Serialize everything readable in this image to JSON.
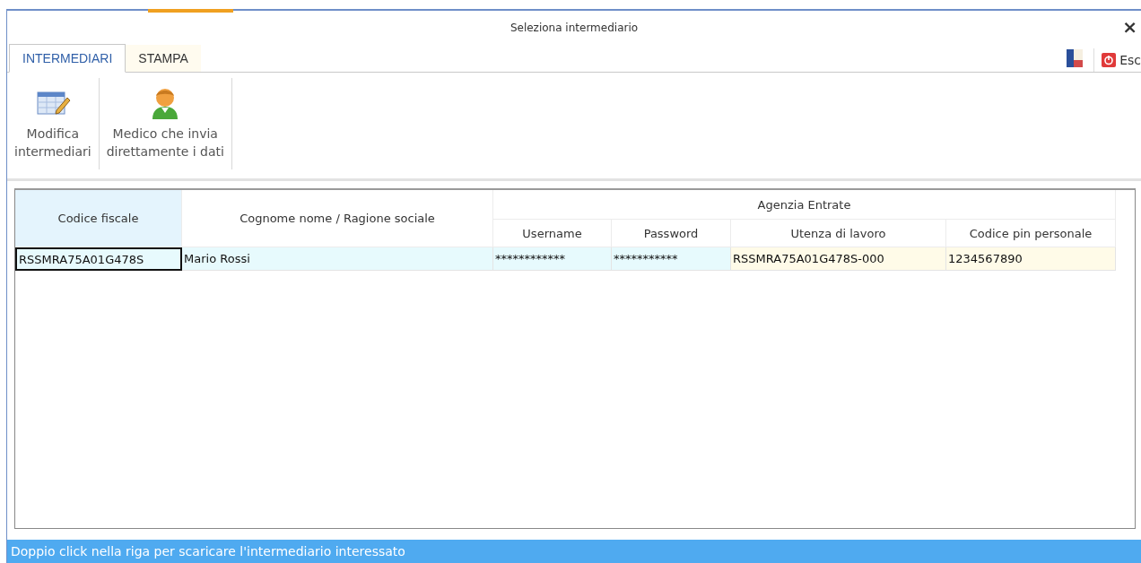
{
  "window": {
    "title": "Seleziona intermediario",
    "close": "×"
  },
  "tabs": [
    {
      "label": "INTERMEDIARI",
      "selected": true
    },
    {
      "label": "STAMPA",
      "selected": false
    }
  ],
  "toolbar_right": {
    "exit": "Esc"
  },
  "ribbon": [
    {
      "kind": "edit",
      "label": "Modifica\nintermediari"
    },
    {
      "kind": "person",
      "label": "Medico che invia\ndirettamente i dati"
    }
  ],
  "table": {
    "columns": [
      {
        "label": "Codice fiscale"
      },
      {
        "label": "Cognome nome / Ragione sociale"
      }
    ],
    "group": {
      "label": "Agenzia Entrate",
      "columns": [
        {
          "label": "Username"
        },
        {
          "label": "Password"
        },
        {
          "label": "Utenza di lavoro"
        },
        {
          "label": "Codice pin personale"
        }
      ]
    },
    "rows": [
      {
        "cells": [
          {
            "text": "RSSMRA75A01G478S",
            "selected": true
          },
          {
            "text": "Mario Rossi",
            "selected": false
          },
          {
            "text": "************",
            "selected": false
          },
          {
            "text": "***********",
            "selected": false
          },
          {
            "text": "RSSMRA75A01G478S-000",
            "selected": false
          },
          {
            "text": "1234567890",
            "selected": false
          }
        ]
      }
    ]
  },
  "status_bar": "Doppio click nella riga per scaricare l'intermediario interessato"
}
